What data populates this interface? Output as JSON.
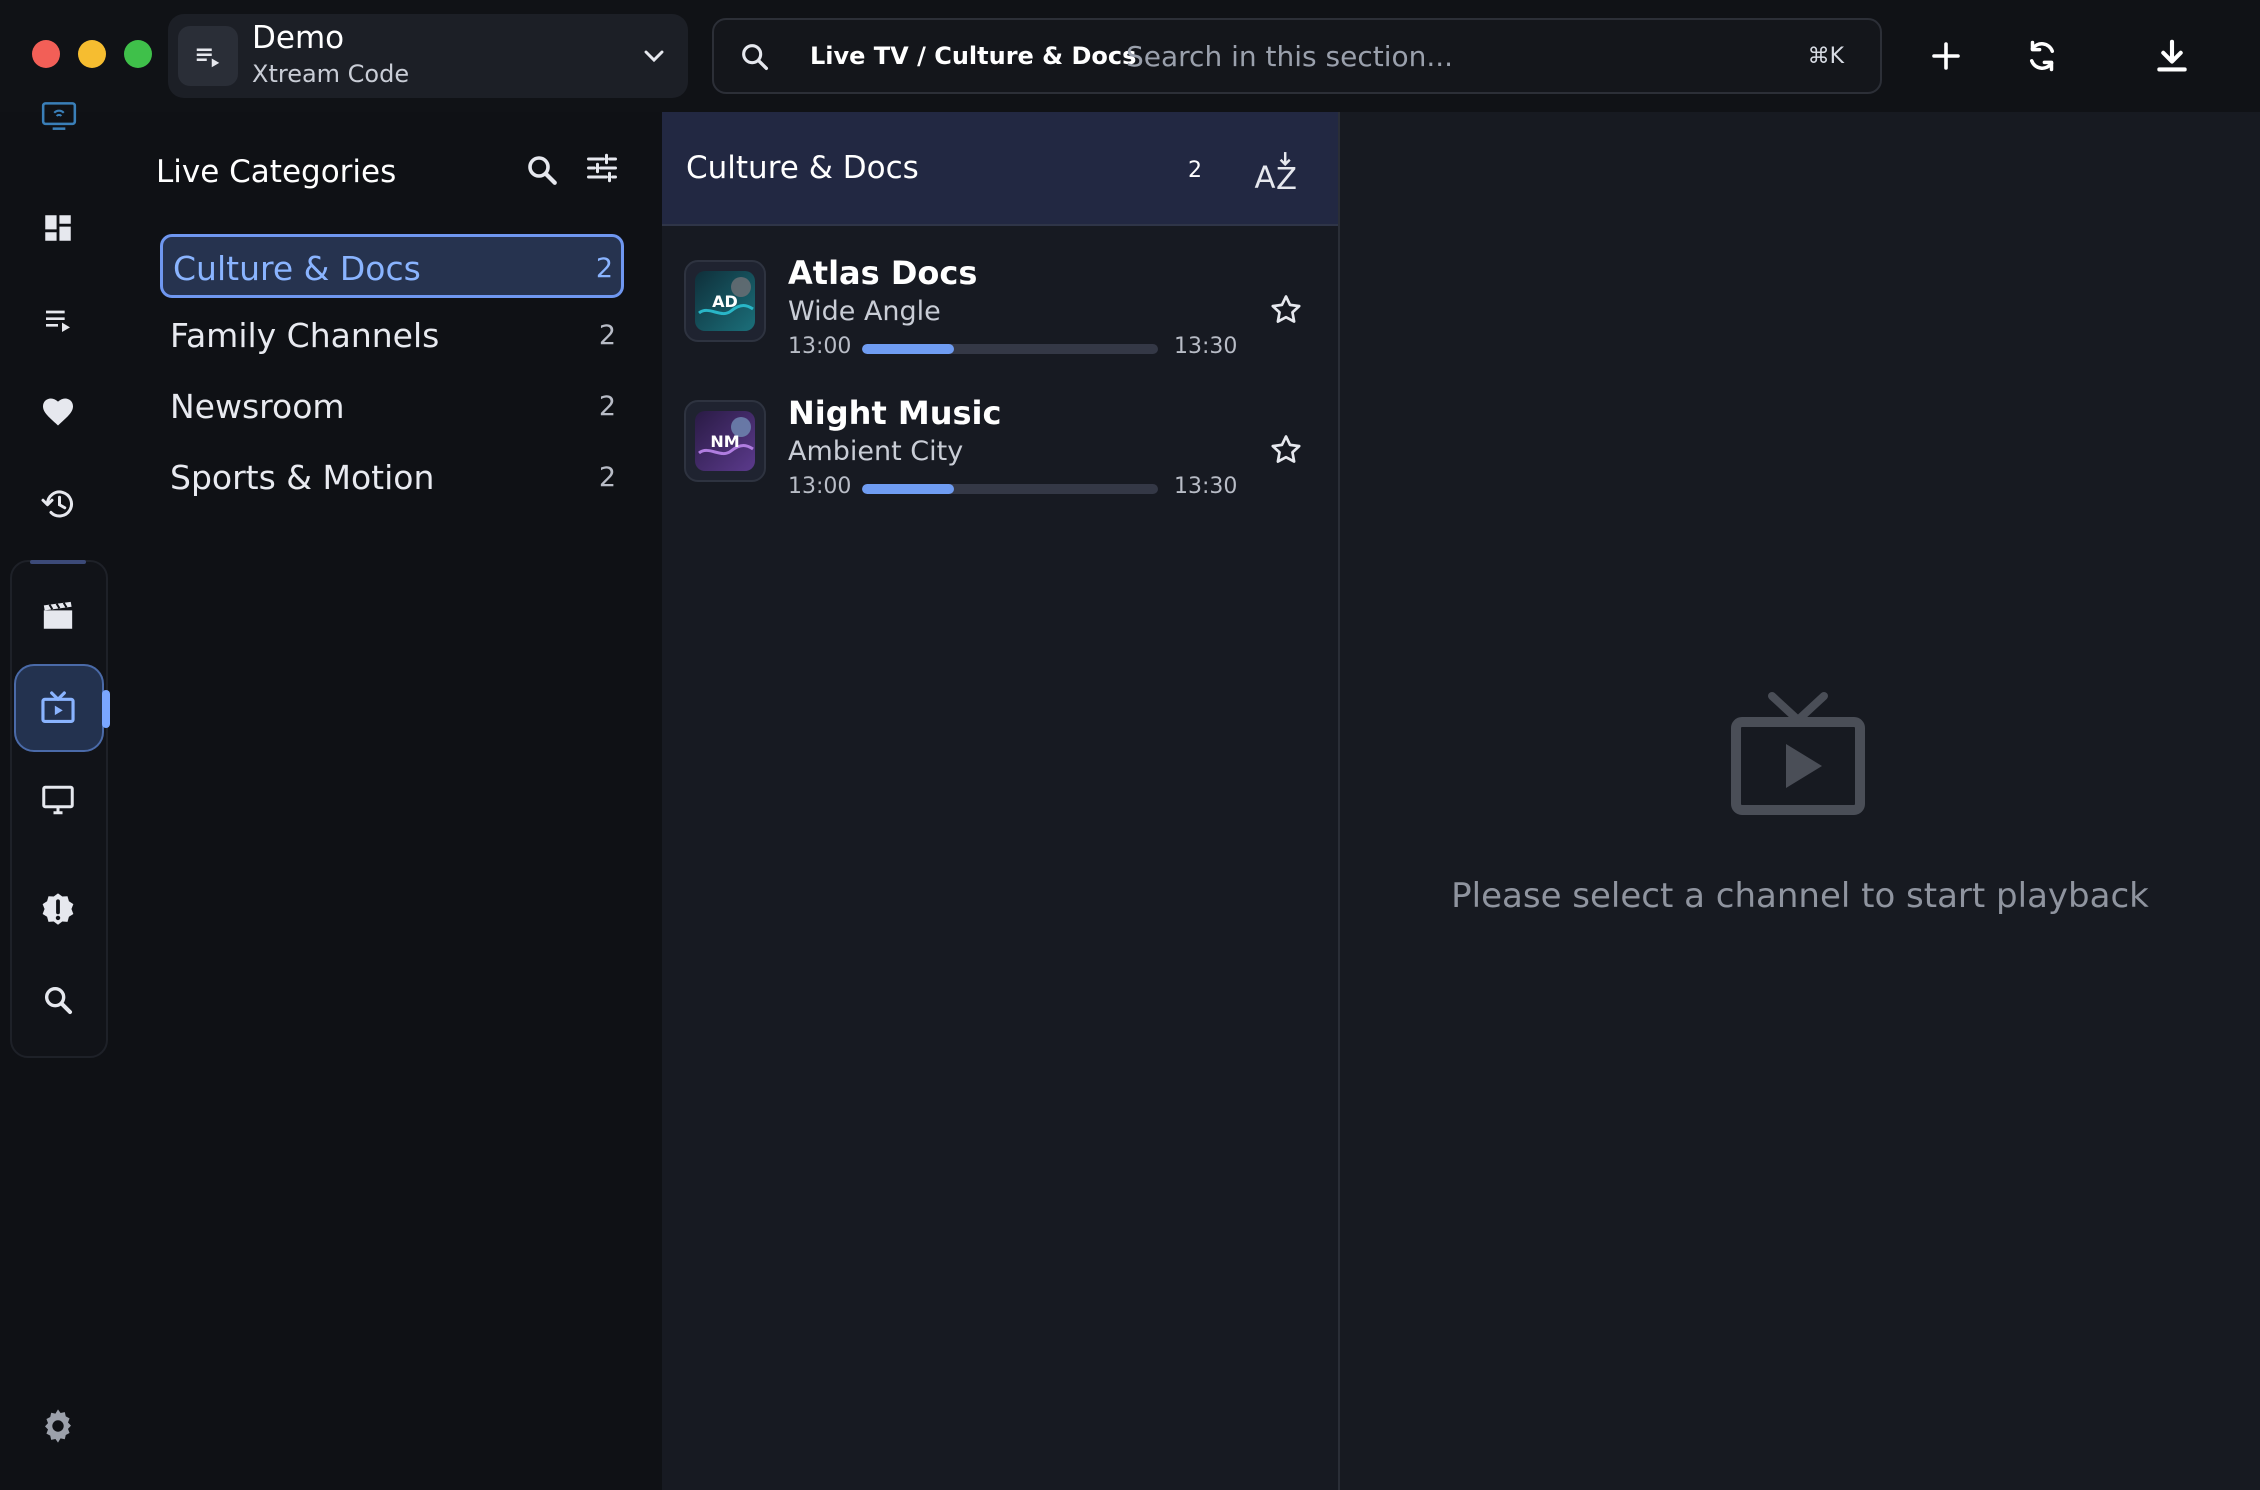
{
  "window": {
    "traffic_lights": {
      "close": "#f25f57",
      "minimize": "#f6bd30",
      "zoom": "#3fc04a"
    }
  },
  "playlist": {
    "name": "Demo",
    "type": "Xtream Code",
    "icon": "playlist-icon",
    "chevron_icon": "chevron-down-icon"
  },
  "search": {
    "breadcrumb": "Live TV / Culture & Docs",
    "placeholder": "Search in this section...",
    "shortcut": "⌘K"
  },
  "toolbar": {
    "add_icon": "plus-icon",
    "refresh_icon": "refresh-icon",
    "download_icon": "download-icon"
  },
  "rail": {
    "items": [
      {
        "icon": "tv-wifi-icon"
      },
      {
        "icon": "dashboard-icon"
      },
      {
        "icon": "playlists-icon"
      },
      {
        "icon": "heart-icon"
      },
      {
        "icon": "history-icon"
      },
      {
        "icon": "movies-icon"
      },
      {
        "icon": "live-tv-icon",
        "active": true
      },
      {
        "icon": "series-icon"
      },
      {
        "icon": "alert-badge-icon"
      },
      {
        "icon": "search-icon"
      },
      {
        "icon": "settings-icon"
      }
    ],
    "accent": "#7aa6ff"
  },
  "categories": {
    "title": "Live Categories",
    "items": [
      {
        "label": "Culture & Docs",
        "count": "2",
        "active": true
      },
      {
        "label": "Family Channels",
        "count": "2"
      },
      {
        "label": "Newsroom",
        "count": "2"
      },
      {
        "label": "Sports & Motion",
        "count": "2"
      }
    ]
  },
  "channel_list": {
    "title": "Culture & Docs",
    "count": "2",
    "sort_icon": "sort-az-icon",
    "channels": [
      {
        "logo": "AD",
        "name": "Atlas Docs",
        "program": "Wide Angle",
        "start": "13:00",
        "end": "13:30",
        "progress": 0.31,
        "logo_color": "#1b6f7a"
      },
      {
        "logo": "NM",
        "name": "Night Music",
        "program": "Ambient City",
        "start": "13:00",
        "end": "13:30",
        "progress": 0.31,
        "logo_color": "#5b3a8c"
      }
    ]
  },
  "player": {
    "empty_message": "Please select a channel to start playback",
    "icon": "live-tv-icon"
  }
}
